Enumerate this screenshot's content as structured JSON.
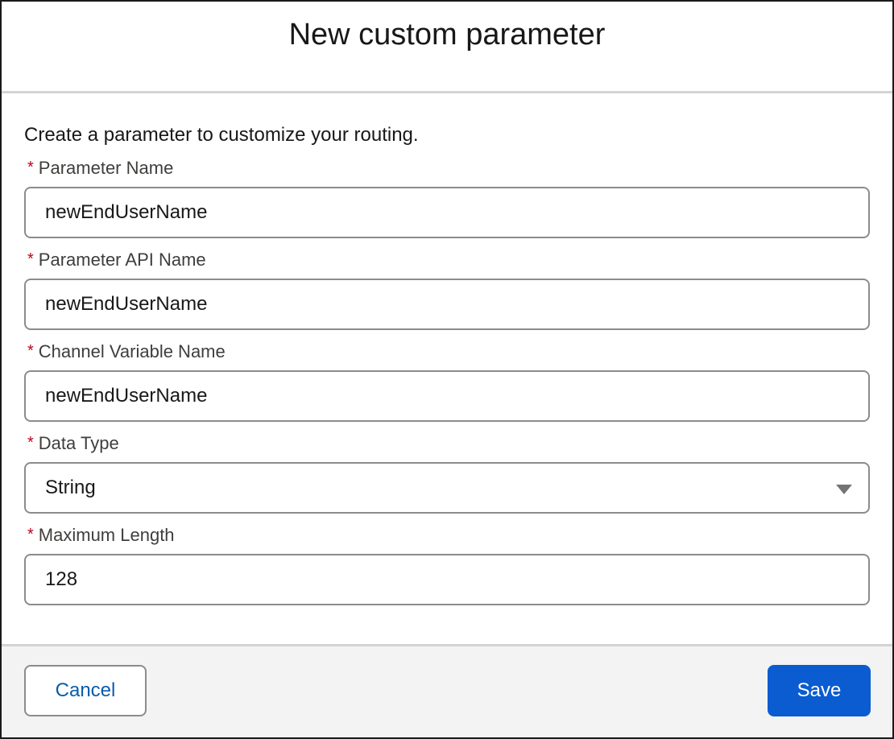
{
  "modal": {
    "title": "New custom parameter",
    "intro": "Create a parameter to customize your routing."
  },
  "fields": [
    {
      "label": "Parameter Name",
      "required_mark": "*",
      "value": "newEndUserName"
    },
    {
      "label": "Parameter API Name",
      "required_mark": "*",
      "value": "newEndUserName"
    },
    {
      "label": "Channel Variable Name",
      "required_mark": "*",
      "value": "newEndUserName"
    },
    {
      "label": "Data Type",
      "required_mark": "*",
      "value": "String",
      "control": "select",
      "icon": "chevron-down-icon"
    },
    {
      "label": "Maximum Length",
      "required_mark": "*",
      "value": "128"
    }
  ],
  "footer": {
    "cancel_label": "Cancel",
    "save_label": "Save"
  },
  "colors": {
    "brand": "#0b5cd0",
    "link": "#0b5cab",
    "required": "#ba0517",
    "footer_bg": "#f3f3f3",
    "border": "#8c8c8c"
  }
}
